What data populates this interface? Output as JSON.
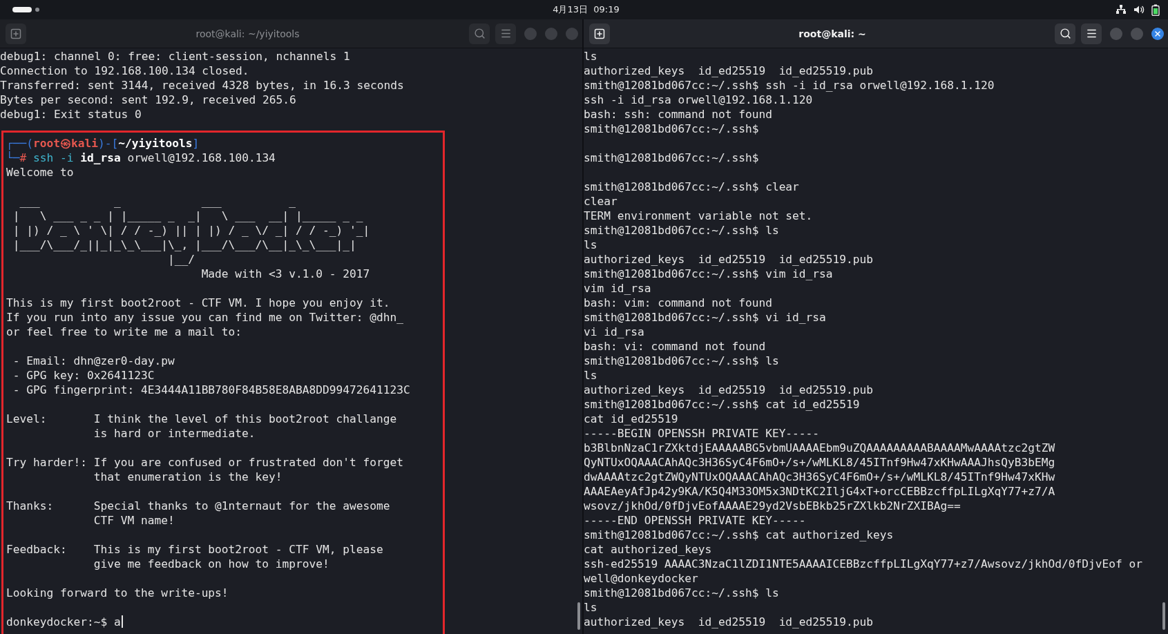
{
  "top_bar": {
    "clock": "4月13日  09:19"
  },
  "windows": [
    {
      "title": "root@kali: ~/yiyitools",
      "active": false,
      "lines": [
        {
          "kind": "text",
          "text": "debug1: channel 0: free: client-session, nchannels 1"
        },
        {
          "kind": "text",
          "text": "Connection to 192.168.100.134 closed."
        },
        {
          "kind": "text",
          "text": "Transferred: sent 3144, received 4328 bytes, in 16.3 seconds"
        },
        {
          "kind": "text",
          "text": "Bytes per second: sent 192.9, received 265.6"
        },
        {
          "kind": "text",
          "text": "debug1: Exit status 0"
        },
        {
          "kind": "blank"
        }
      ],
      "highlighted_lines": [
        {
          "kind": "prompt",
          "segments": [
            {
              "text": "┌──(",
              "kind": "decoration"
            },
            {
              "text": "root㉿kali",
              "kind": "user_host"
            },
            {
              "text": ")-[",
              "kind": "decoration"
            },
            {
              "text": "~/yiyitools",
              "kind": "path"
            },
            {
              "text": "]",
              "kind": "decoration"
            }
          ]
        },
        {
          "kind": "prompt",
          "segments": [
            {
              "text": "└─",
              "kind": "decoration"
            },
            {
              "text": "# ",
              "kind": "prompt_symbol"
            },
            {
              "text": "ssh -i ",
              "kind": "command"
            },
            {
              "text": "id_rsa",
              "kind": "argument"
            },
            {
              "text": " orwell@192.168.100.134",
              "kind": "text"
            }
          ]
        },
        {
          "kind": "text",
          "text": "Welcome to"
        },
        {
          "kind": "blank"
        },
        {
          "kind": "art",
          "text": "  ___           _            ___          _"
        },
        {
          "kind": "art",
          "text": " |   \\ ___ _ _ | |_____ _  _|   \\ ___  __| |_____ _ _"
        },
        {
          "kind": "art",
          "text": " | |) / _ \\ ' \\| / / -_) || | |) / _ \\/ _| / / -_) '_|"
        },
        {
          "kind": "art",
          "text": " |___/\\___/_||_|_\\_\\___|\\_, |___/\\___/\\__|_\\_\\___|_|"
        },
        {
          "kind": "art",
          "text": "                        |__/"
        },
        {
          "kind": "text",
          "text": "                             Made with <3 v.1.0 - 2017"
        },
        {
          "kind": "blank"
        },
        {
          "kind": "text",
          "text": "This is my first boot2root - CTF VM. I hope you enjoy it."
        },
        {
          "kind": "text",
          "text": "If you run into any issue you can find me on Twitter: @dhn_"
        },
        {
          "kind": "text",
          "text": "or feel free to write me a mail to:"
        },
        {
          "kind": "blank"
        },
        {
          "kind": "text",
          "text": " - Email: dhn@zer0-day.pw"
        },
        {
          "kind": "text",
          "text": " - GPG key: 0x2641123C"
        },
        {
          "kind": "text",
          "text": " - GPG fingerprint: 4E3444A11BB780F84B58E8ABA8DD99472641123C"
        },
        {
          "kind": "blank"
        },
        {
          "kind": "text",
          "text": "Level:       I think the level of this boot2root challange"
        },
        {
          "kind": "text",
          "text": "             is hard or intermediate."
        },
        {
          "kind": "blank"
        },
        {
          "kind": "text",
          "text": "Try harder!: If you are confused or frustrated don't forget"
        },
        {
          "kind": "text",
          "text": "             that enumeration is the key!"
        },
        {
          "kind": "blank"
        },
        {
          "kind": "text",
          "text": "Thanks:      Special thanks to @1nternaut for the awesome"
        },
        {
          "kind": "text",
          "text": "             CTF VM name!"
        },
        {
          "kind": "blank"
        },
        {
          "kind": "text",
          "text": "Feedback:    This is my first boot2root - CTF VM, please"
        },
        {
          "kind": "text",
          "text": "             give me feedback on how to improve!"
        },
        {
          "kind": "blank"
        },
        {
          "kind": "text",
          "text": "Looking forward to the write-ups!"
        },
        {
          "kind": "blank"
        },
        {
          "kind": "text",
          "text": "donkeydocker:~$ a",
          "cursor": true
        }
      ]
    },
    {
      "title": "root@kali: ~",
      "active": true,
      "lines": [
        {
          "kind": "text",
          "text": "ls"
        },
        {
          "kind": "text",
          "text": "authorized_keys  id_ed25519  id_ed25519.pub"
        },
        {
          "kind": "text",
          "text": "smith@12081bd067cc:~/.ssh$ ssh -i id_rsa orwell@192.168.1.120"
        },
        {
          "kind": "text",
          "text": "ssh -i id_rsa orwell@192.168.1.120"
        },
        {
          "kind": "text",
          "text": "bash: ssh: command not found"
        },
        {
          "kind": "text",
          "text": "smith@12081bd067cc:~/.ssh$"
        },
        {
          "kind": "blank"
        },
        {
          "kind": "text",
          "text": "smith@12081bd067cc:~/.ssh$"
        },
        {
          "kind": "blank"
        },
        {
          "kind": "text",
          "text": "smith@12081bd067cc:~/.ssh$ clear"
        },
        {
          "kind": "text",
          "text": "clear"
        },
        {
          "kind": "text",
          "text": "TERM environment variable not set."
        },
        {
          "kind": "text",
          "text": "smith@12081bd067cc:~/.ssh$ ls"
        },
        {
          "kind": "text",
          "text": "ls"
        },
        {
          "kind": "text",
          "text": "authorized_keys  id_ed25519  id_ed25519.pub"
        },
        {
          "kind": "text",
          "text": "smith@12081bd067cc:~/.ssh$ vim id_rsa"
        },
        {
          "kind": "text",
          "text": "vim id_rsa"
        },
        {
          "kind": "text",
          "text": "bash: vim: command not found"
        },
        {
          "kind": "text",
          "text": "smith@12081bd067cc:~/.ssh$ vi id_rsa"
        },
        {
          "kind": "text",
          "text": "vi id_rsa"
        },
        {
          "kind": "text",
          "text": "bash: vi: command not found"
        },
        {
          "kind": "text",
          "text": "smith@12081bd067cc:~/.ssh$ ls"
        },
        {
          "kind": "text",
          "text": "ls"
        },
        {
          "kind": "text",
          "text": "authorized_keys  id_ed25519  id_ed25519.pub"
        },
        {
          "kind": "text",
          "text": "smith@12081bd067cc:~/.ssh$ cat id_ed25519"
        },
        {
          "kind": "text",
          "text": "cat id_ed25519"
        },
        {
          "kind": "text",
          "text": "-----BEGIN OPENSSH PRIVATE KEY-----"
        },
        {
          "kind": "text",
          "text": "b3BlbnNzaC1rZXktdjEAAAAABG5vbmUAAAAEbm9uZQAAAAAAAAABAAAAMwAAAAtzc2gtZW"
        },
        {
          "kind": "text",
          "text": "QyNTUxOQAAACAhAQc3H36SyC4F6mO+/s+/wMLKL8/45ITnf9Hw47xKHwAAAJhsQyB3bEMg"
        },
        {
          "kind": "text",
          "text": "dwAAAAtzc2gtZWQyNTUxOQAAACAhAQc3H36SyC4F6mO+/s+/wMLKL8/45ITnf9Hw47xKHw"
        },
        {
          "kind": "text",
          "text": "AAAEAeyAfJp42y9KA/K5Q4M33OM5x3NDtKC2IljG4xT+orcCEBBzcffpLILgXqY77+z7/A"
        },
        {
          "kind": "text",
          "text": "wsovz/jkhOd/0fDjvEofAAAAE29yd2VsbEBkb25rZXlkb2NrZXIBAg=="
        },
        {
          "kind": "text",
          "text": "-----END OPENSSH PRIVATE KEY-----"
        },
        {
          "kind": "text",
          "text": "smith@12081bd067cc:~/.ssh$ cat authorized_keys"
        },
        {
          "kind": "text",
          "text": "cat authorized_keys"
        },
        {
          "kind": "text",
          "text": "ssh-ed25519 AAAAC3NzaC1lZDI1NTE5AAAAICEBBzcffpLILgXqY77+z7/Awsovz/jkhOd/0fDjvEof or"
        },
        {
          "kind": "text",
          "text": "well@donkeydocker"
        },
        {
          "kind": "text",
          "text": "smith@12081bd067cc:~/.ssh$ ls"
        },
        {
          "kind": "text",
          "text": "ls"
        },
        {
          "kind": "text",
          "text": "authorized_keys  id_ed25519  id_ed25519.pub"
        }
      ]
    }
  ]
}
